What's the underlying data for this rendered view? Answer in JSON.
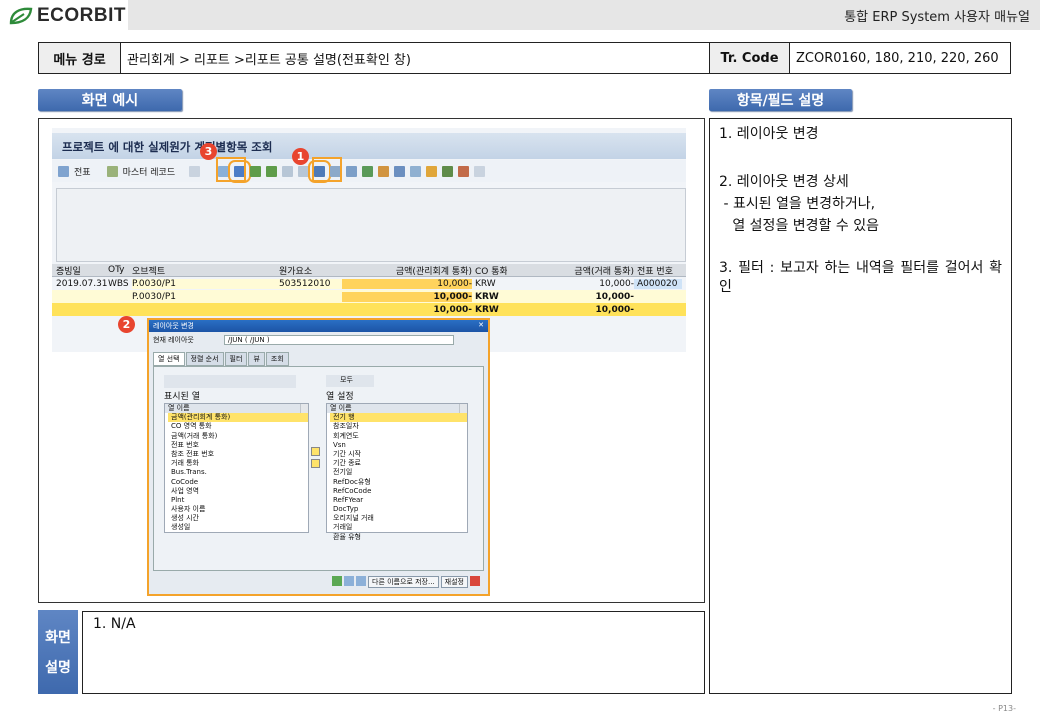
{
  "header": {
    "logo": "ECORBIT",
    "title": "통합 ERP System 사용자 매뉴얼"
  },
  "path_row": {
    "menu_label": "메뉴 경로",
    "menu_path": "관리회계 > 리포트 >리포트 공통 설명(전표확인 창)",
    "tr_label": "Tr. Code",
    "tr_value": "ZCOR0160, 180, 210, 220, 260"
  },
  "sections": {
    "example": "화면 예시",
    "fields": "항목/필드 설명",
    "desc_label_1": "화면",
    "desc_label_2": "설명"
  },
  "field_desc": [
    "1.  레이아웃 변경",
    "2.  레이아웃 변경 상세",
    " - 표시된 열을 변경하거나,",
    "   열 설정을 변경할 수 있음",
    "3. 필터 : 보고자 하는 내역을 필터를 걸어서 확인"
  ],
  "screen_desc": "1.  N/A",
  "page_number": "- P13-",
  "screenshot": {
    "title": "프로젝트 에 대한 실제원가 계정별항목 조회",
    "toolbar": {
      "doc_label": "전표",
      "master_label": "마스터 레코드"
    },
    "badges": [
      "3",
      "1",
      "2"
    ],
    "columns": [
      "증빙일",
      "OTy",
      "오브젝트",
      "원가요소",
      "금액(관리회계 통화)",
      "CO 통화",
      "금액(거래 통화)",
      "전표 번호"
    ],
    "rows": [
      {
        "date": "2019.07.31",
        "oty": "WBS",
        "object": "P.0030/P1",
        "cost_elem": "503512010",
        "amount": "10,000-",
        "currency": "KRW",
        "amount_tx": "10,000-",
        "doc_no": "A000020"
      },
      {
        "date": "",
        "oty": "",
        "object": "P.0030/P1",
        "cost_elem": "",
        "amount": "10,000-",
        "currency": "KRW",
        "amount_tx": "10,000-",
        "doc_no": ""
      },
      {
        "date": "",
        "oty": "",
        "object": "",
        "cost_elem": "",
        "amount": "10,000-",
        "currency": "KRW",
        "amount_tx": "10,000-",
        "doc_no": ""
      }
    ],
    "dialog": {
      "title": "레이아웃 변경",
      "current_layout_label": "현재 레이아웃",
      "current_layout_value": "/JUN ( /JUN )",
      "tabs": [
        "열 선택",
        "정렬 순서",
        "필터",
        "뷰",
        "조회"
      ],
      "displayed_header": "표시된 열",
      "column_set_header": "열 설정",
      "col_name_label": "열 이름",
      "all_label": "모두",
      "displayed_items": [
        "금액(관리회계 통화)",
        "CO 영역 통화",
        "금액(거래 통화)",
        "전표 번호",
        "참조 전표 번호",
        "거래 통화",
        "Bus.Trans.",
        "CoCode",
        "사업 영역",
        "Plnt",
        "사용자 이름",
        "생성 시간",
        "생성일"
      ],
      "set_items": [
        "전기 행",
        "참조일자",
        "회계연도",
        "Vsn",
        "기간 시작",
        "기간 종료",
        "전기일",
        "RefDoc유형",
        "RefCoCode",
        "RefFYear",
        "DocTyp",
        "오리지널 거래",
        "거래일",
        "환율 유형"
      ],
      "save_as_label": "다른 이름으로 저장...",
      "reset_label": "재설정"
    }
  }
}
